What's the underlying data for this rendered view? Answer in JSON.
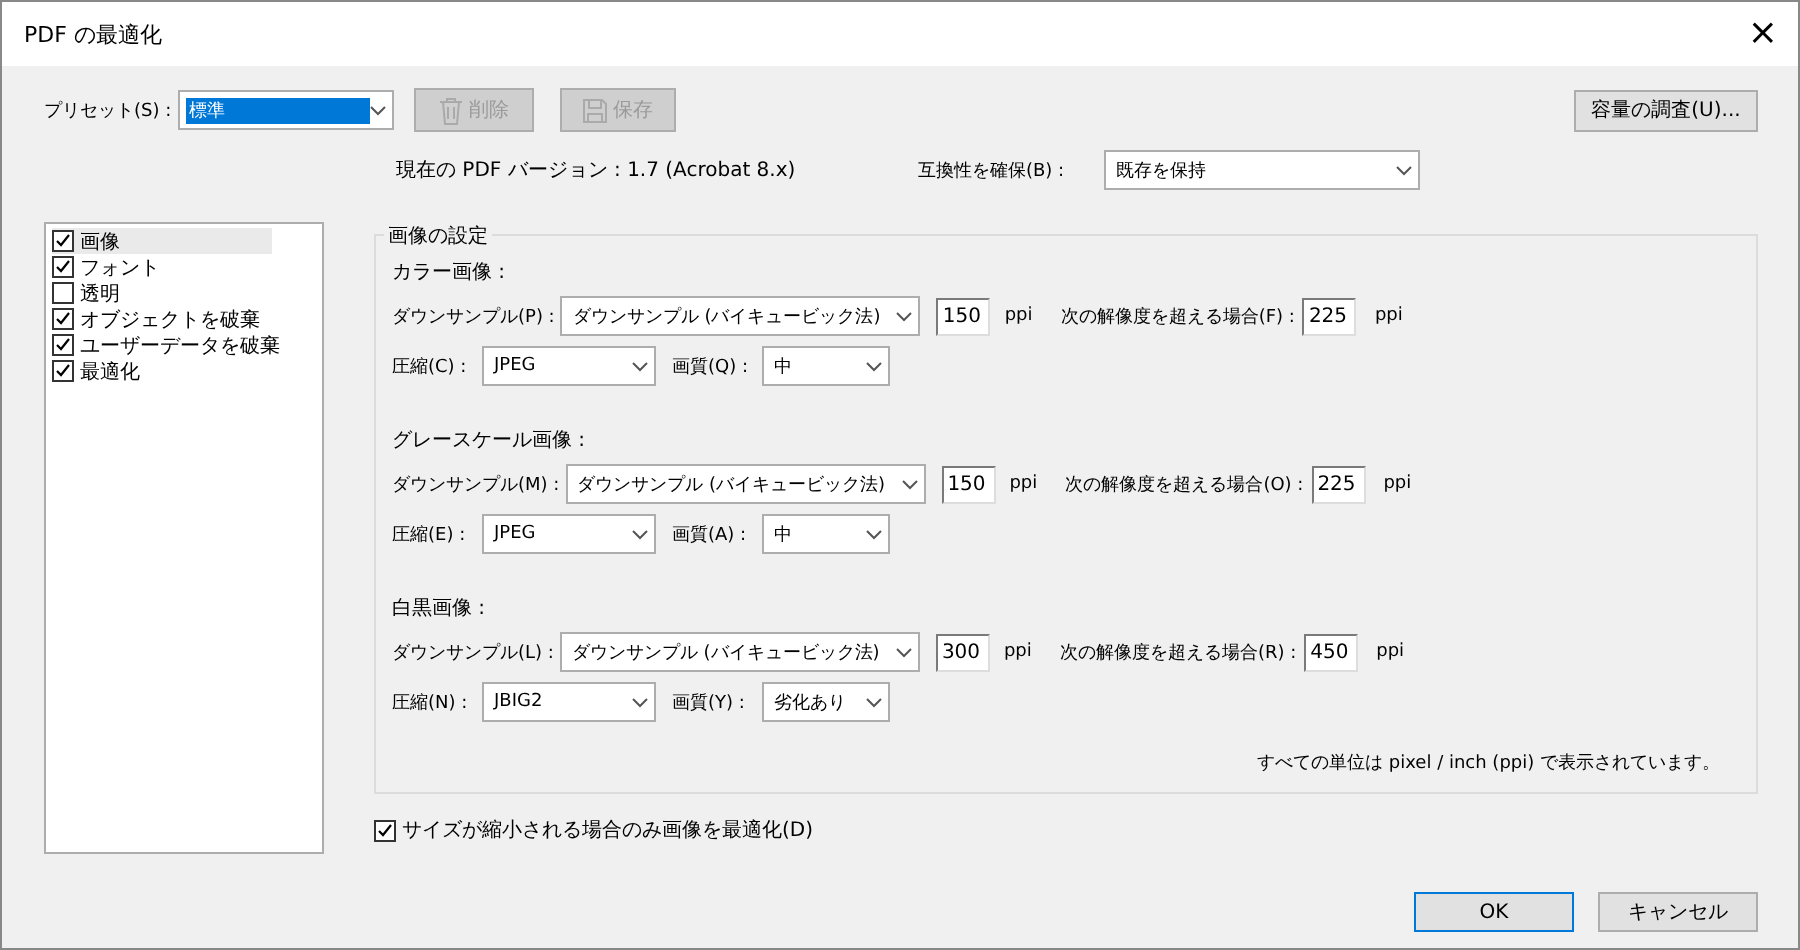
{
  "window": {
    "title": "PDF の最適化",
    "close": "×"
  },
  "preset": {
    "label": "プリセット(S) :",
    "value": "標準",
    "delete": {
      "label": "削除",
      "disabled": true
    },
    "save": {
      "label": "保存",
      "disabled": true
    }
  },
  "audit_button": "容量の調査(U)...",
  "version": "現在の PDF バージョン : 1.7 (Acrobat 8.x)",
  "compat": {
    "label": "互換性を確保(B) :",
    "value": "既存を保持"
  },
  "panels": [
    {
      "label": "画像",
      "checked": true,
      "selected": true
    },
    {
      "label": "フォント",
      "checked": true,
      "selected": false
    },
    {
      "label": "透明",
      "checked": false,
      "selected": false
    },
    {
      "label": "オブジェクトを破棄",
      "checked": true,
      "selected": false
    },
    {
      "label": "ユーザーデータを破棄",
      "checked": true,
      "selected": false
    },
    {
      "label": "最適化",
      "checked": true,
      "selected": false
    }
  ],
  "group": {
    "title": "画像の設定",
    "sections": [
      {
        "title": "カラー画像 :",
        "downsample_label": "ダウンサンプル(P) :",
        "method": "ダウンサンプル (バイキュービック法)",
        "resolution": "150",
        "unit": "ppi",
        "threshold_label": "次の解像度を超える場合(F) :",
        "threshold": "225",
        "threshold_unit": "ppi",
        "compression_label": "圧縮(C) :",
        "compression": "JPEG",
        "quality_label": "画質(Q) :",
        "quality": "中"
      },
      {
        "title": "グレースケール画像 :",
        "downsample_label": "ダウンサンプル(M) :",
        "method": "ダウンサンプル (バイキュービック法)",
        "resolution": "150",
        "unit": "ppi",
        "threshold_label": "次の解像度を超える場合(O) :",
        "threshold": "225",
        "threshold_unit": "ppi",
        "compression_label": "圧縮(E) :",
        "compression": "JPEG",
        "quality_label": "画質(A) :",
        "quality": "中"
      },
      {
        "title": "白黒画像 :",
        "downsample_label": "ダウンサンプル(L) :",
        "method": "ダウンサンプル (バイキュービック法)",
        "resolution": "300",
        "unit": "ppi",
        "threshold_label": "次の解像度を超える場合(R) :",
        "threshold": "450",
        "threshold_unit": "ppi",
        "compression_label": "圧縮(N) :",
        "compression": "JBIG2",
        "quality_label": "画質(Y) :",
        "quality": "劣化あり"
      }
    ],
    "note": "すべての単位は pixel / inch (ppi) で表示されています。"
  },
  "shrink_only": {
    "label": "サイズが縮小される場合のみ画像を最適化(D)",
    "checked": true
  },
  "buttons": [
    {
      "label": "OK",
      "default": true
    },
    {
      "label": "キャンセル",
      "default": false
    }
  ]
}
